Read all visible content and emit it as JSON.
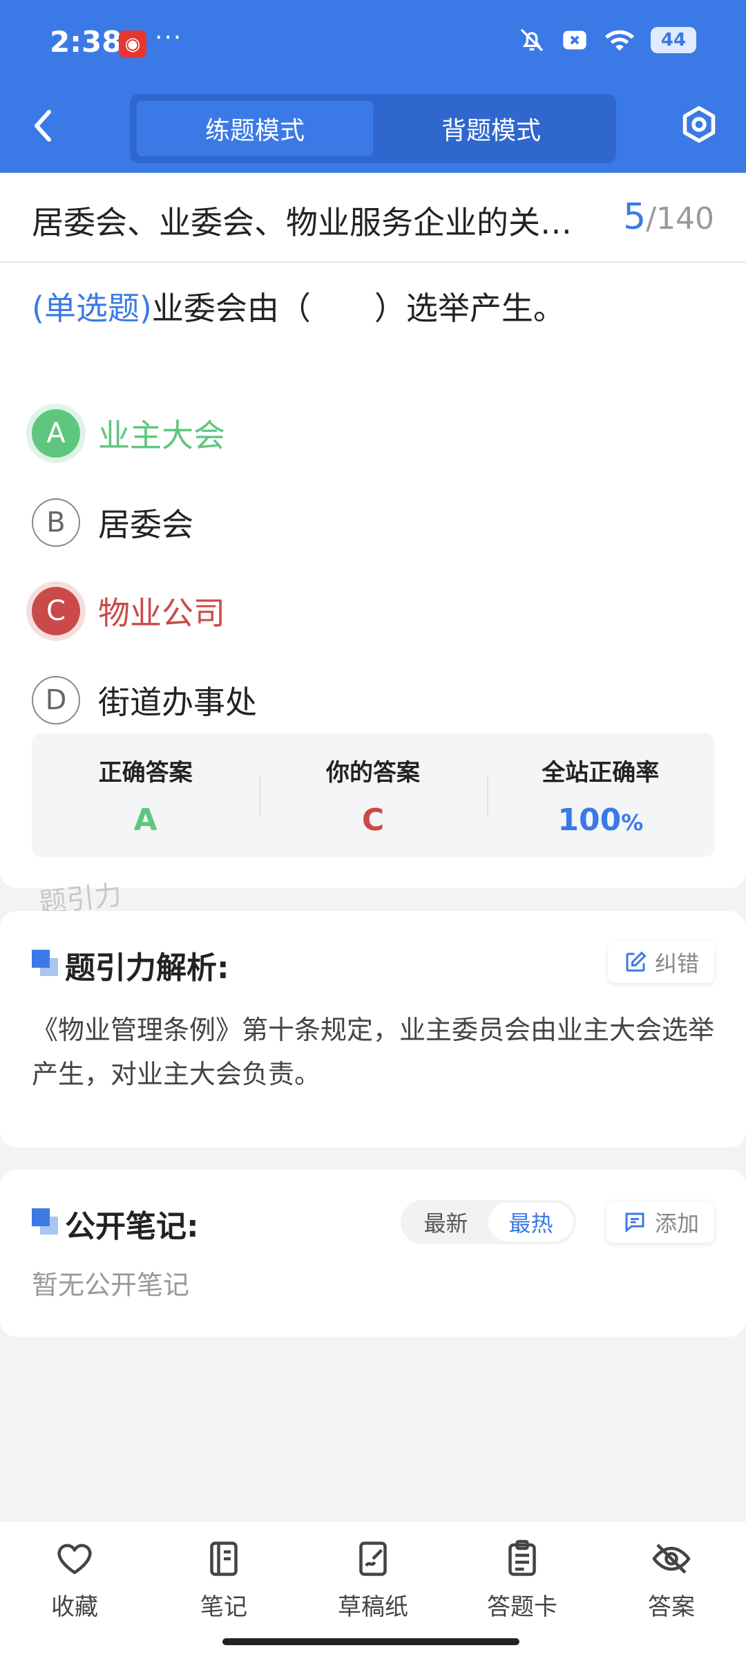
{
  "status_bar": {
    "time": "2:38",
    "dots": "···",
    "battery": "44"
  },
  "header": {
    "tabs": [
      {
        "label": "练题模式",
        "active": true
      },
      {
        "label": "背题模式",
        "active": false
      }
    ]
  },
  "question": {
    "title": "居委会、业委会、物业服务企业的关…",
    "current": "5",
    "separator": "/",
    "total": "140",
    "type_label": "(单选题)",
    "text": "业委会由（　　）选举产生。",
    "options": [
      {
        "letter": "A",
        "text": "业主大会",
        "state": "correct"
      },
      {
        "letter": "B",
        "text": "居委会",
        "state": "normal"
      },
      {
        "letter": "C",
        "text": "物业公司",
        "state": "wrong"
      },
      {
        "letter": "D",
        "text": "街道办事处",
        "state": "normal"
      }
    ]
  },
  "result": {
    "correct_label": "正确答案",
    "correct_value": "A",
    "yours_label": "你的答案",
    "yours_value": "C",
    "rate_label": "全站正确率",
    "rate_value": "100",
    "rate_unit": "%"
  },
  "watermark": "题引力",
  "analysis": {
    "title": "题引力解析:",
    "report_label": "纠错",
    "text": "《物业管理条例》第十条规定，业主委员会由业主大会选举产生，对业主大会负责。"
  },
  "notes": {
    "title": "公开笔记:",
    "sort_newest": "最新",
    "sort_hottest": "最热",
    "add_label": "添加",
    "empty_text": "暂无公开笔记"
  },
  "bottom_nav": [
    {
      "label": "收藏",
      "icon": "heart-icon"
    },
    {
      "label": "笔记",
      "icon": "notebook-icon"
    },
    {
      "label": "草稿纸",
      "icon": "draft-icon"
    },
    {
      "label": "答题卡",
      "icon": "clipboard-icon"
    },
    {
      "label": "答案",
      "icon": "eye-off-icon"
    }
  ],
  "colors": {
    "primary": "#3b7ae6",
    "correct": "#5ec67e",
    "wrong": "#c94a48"
  }
}
